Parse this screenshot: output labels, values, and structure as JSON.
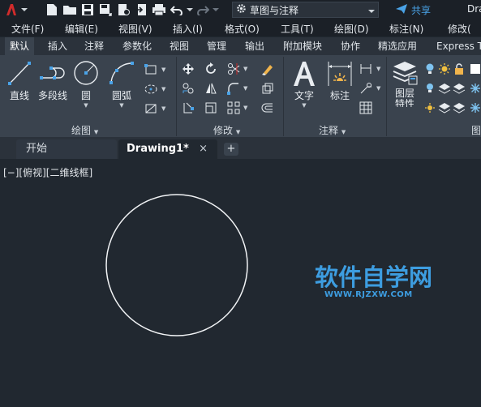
{
  "app": {
    "title_fragment": "Dra",
    "workspace": "草图与注释",
    "share_label": "共享"
  },
  "menu": [
    "文件(F)",
    "编辑(E)",
    "视图(V)",
    "插入(I)",
    "格式(O)",
    "工具(T)",
    "绘图(D)",
    "标注(N)",
    "修改("
  ],
  "ribbon_tabs": [
    "默认",
    "插入",
    "注释",
    "参数化",
    "视图",
    "管理",
    "输出",
    "附加模块",
    "协作",
    "精选应用",
    "Express T"
  ],
  "draw_panel": {
    "title": "绘图",
    "tools": [
      "直线",
      "多段线",
      "圆",
      "圆弧"
    ]
  },
  "modify_panel": {
    "title": "修改"
  },
  "annotation_panel": {
    "title": "注释",
    "tools": [
      "文字",
      "标注"
    ]
  },
  "layers_panel": {
    "tool_line1": "图层",
    "tool_line2": "特性",
    "title_fragment": "图"
  },
  "doc_tabs": {
    "start": "开始",
    "active": "Drawing1*",
    "close": "×",
    "add": "+"
  },
  "canvas": {
    "view_label": "[−][俯视][二维线框]"
  },
  "watermark": {
    "cn": "软件自学网",
    "en": "WWW.RJZXW.COM"
  },
  "colors": {
    "accent": "#4aa3e8",
    "logo_red": "#d02b2b",
    "canvas_bg": "#212830",
    "ribbon_bg": "#3a434e",
    "watermark": "#3d9de0"
  }
}
